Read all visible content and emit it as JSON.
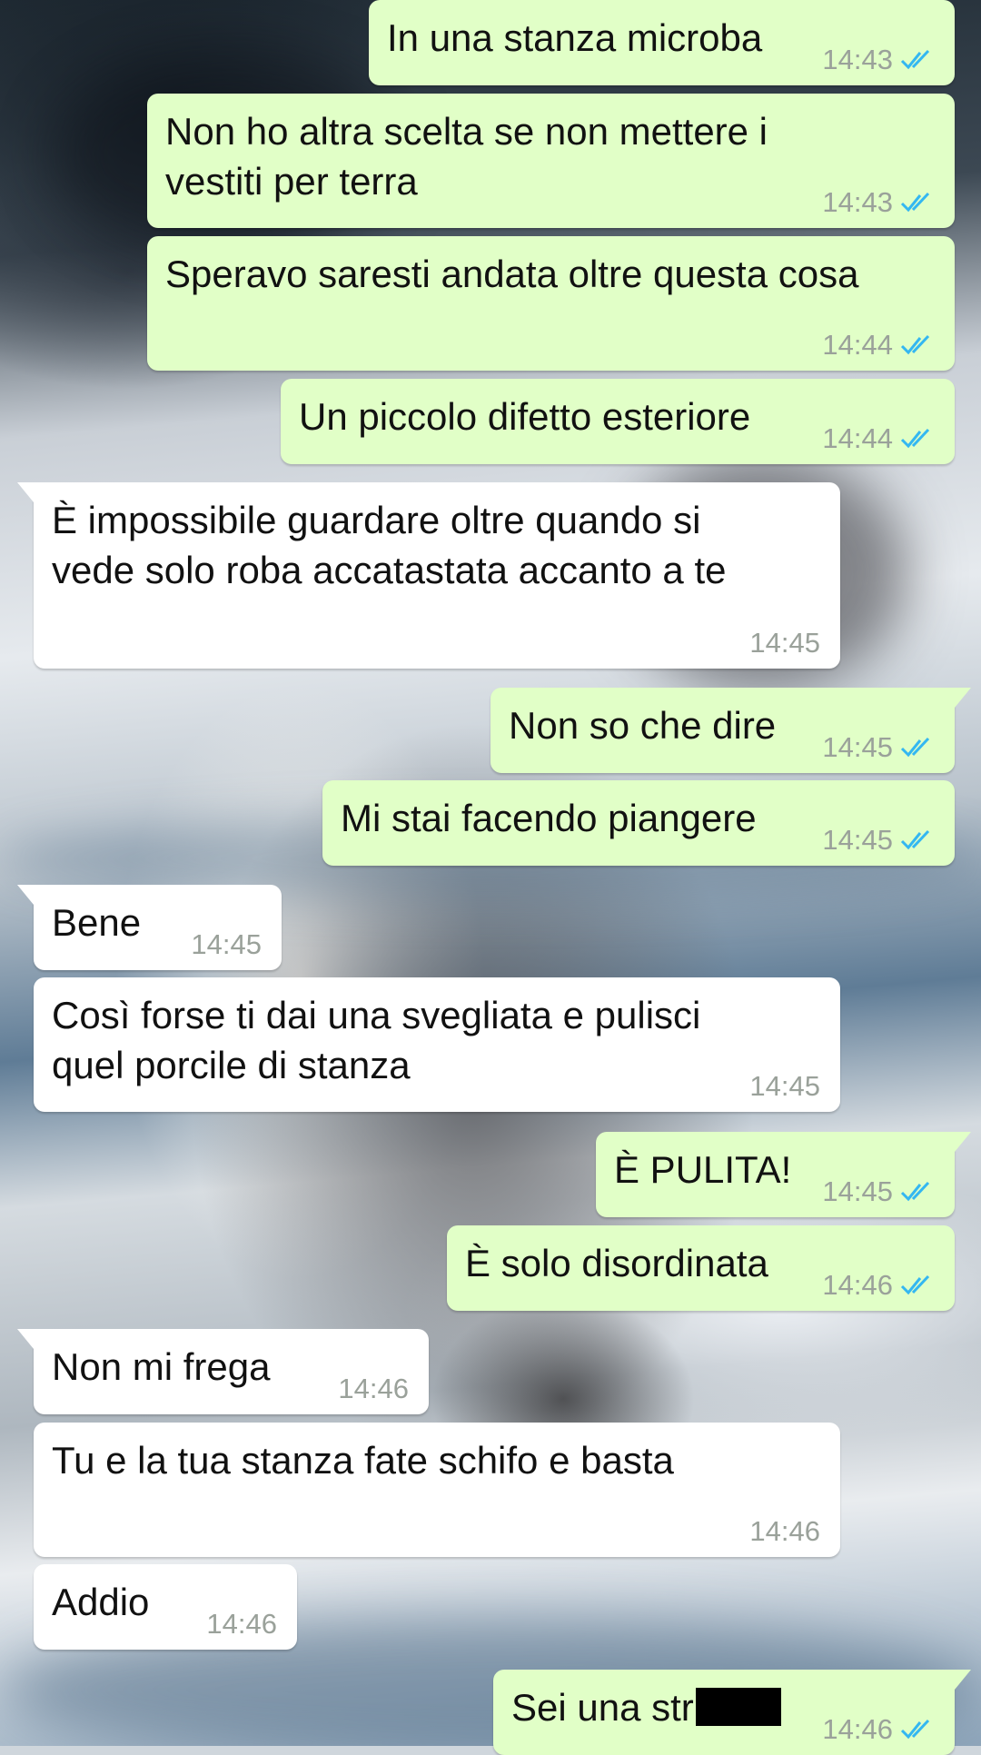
{
  "colors": {
    "outgoing_bubble": "#e1ffc7",
    "incoming_bubble": "#ffffff",
    "read_ticks": "#34b7f1",
    "timestamp": "#9aa19a"
  },
  "messages": [
    {
      "direction": "out",
      "text": "In una stanza microba",
      "time": "14:43",
      "status_icon": "double-check-read-icon"
    },
    {
      "direction": "out",
      "text": "Non ho altra scelta se non mettere i\nvestiti per terra",
      "time": "14:43",
      "status_icon": "double-check-read-icon"
    },
    {
      "direction": "out",
      "text": "Speravo saresti andata oltre questa cosa",
      "time": "14:44",
      "status_icon": "double-check-read-icon"
    },
    {
      "direction": "out",
      "text": "Un piccolo difetto esteriore",
      "time": "14:44",
      "status_icon": "double-check-read-icon"
    },
    {
      "direction": "in",
      "text": "È impossibile guardare oltre quando si\nvede solo roba accatastata accanto a te",
      "time": "14:45"
    },
    {
      "direction": "out",
      "text": "Non so che dire",
      "time": "14:45",
      "status_icon": "double-check-read-icon"
    },
    {
      "direction": "out",
      "text": "Mi stai facendo piangere",
      "time": "14:45",
      "status_icon": "double-check-read-icon"
    },
    {
      "direction": "in",
      "text": "Bene",
      "time": "14:45"
    },
    {
      "direction": "in",
      "text": "Così forse ti dai una svegliata e pulisci\nquel porcile di stanza",
      "time": "14:45"
    },
    {
      "direction": "out",
      "text": "È PULITA!",
      "time": "14:45",
      "status_icon": "double-check-read-icon"
    },
    {
      "direction": "out",
      "text": "È solo disordinata",
      "time": "14:46",
      "status_icon": "double-check-read-icon"
    },
    {
      "direction": "in",
      "text": "Non mi frega",
      "time": "14:46"
    },
    {
      "direction": "in",
      "text": "Tu e la tua stanza fate schifo e basta",
      "time": "14:46"
    },
    {
      "direction": "in",
      "text": "Addio",
      "time": "14:46"
    },
    {
      "direction": "out",
      "text": "Sei una str",
      "time": "14:46",
      "status_icon": "double-check-read-icon",
      "redacted_tail": true
    }
  ]
}
